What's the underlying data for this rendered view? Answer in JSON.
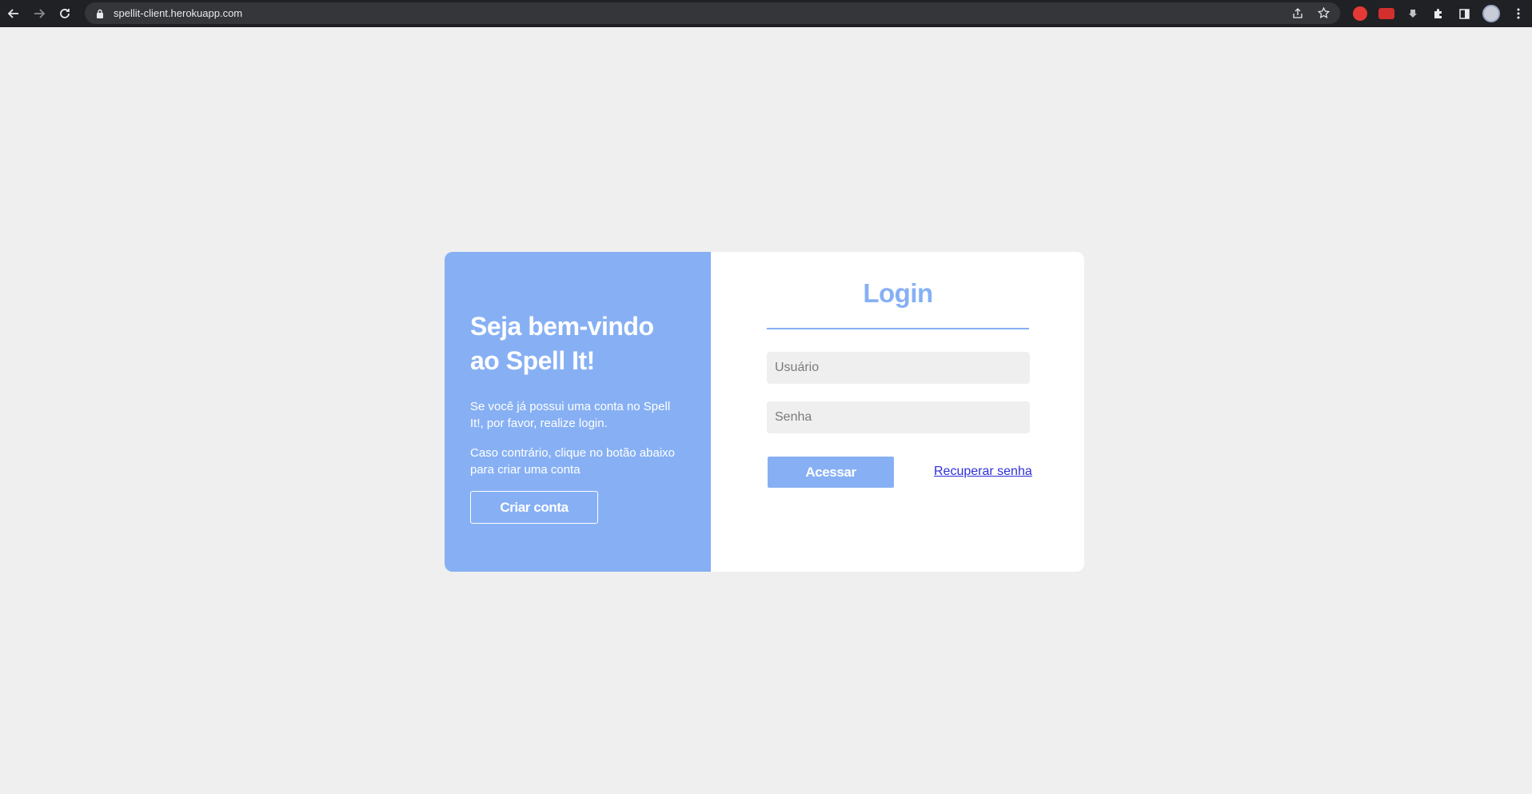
{
  "browser": {
    "url": "spellit-client.herokuapp.com"
  },
  "welcome": {
    "title": "Seja bem-vindo ao Spell It!",
    "text1": "Se você já possui uma conta no Spell It!, por favor, realize login.",
    "text2": "Caso contrário, clique no botão abaixo para criar uma conta",
    "create_label": "Criar conta"
  },
  "login": {
    "title": "Login",
    "username_placeholder": "Usuário",
    "password_placeholder": "Senha",
    "submit_label": "Acessar",
    "recover_label": "Recuperar senha"
  },
  "colors": {
    "accent": "#87b0f4",
    "page_bg": "#efefef",
    "link": "#2f2fd8"
  }
}
